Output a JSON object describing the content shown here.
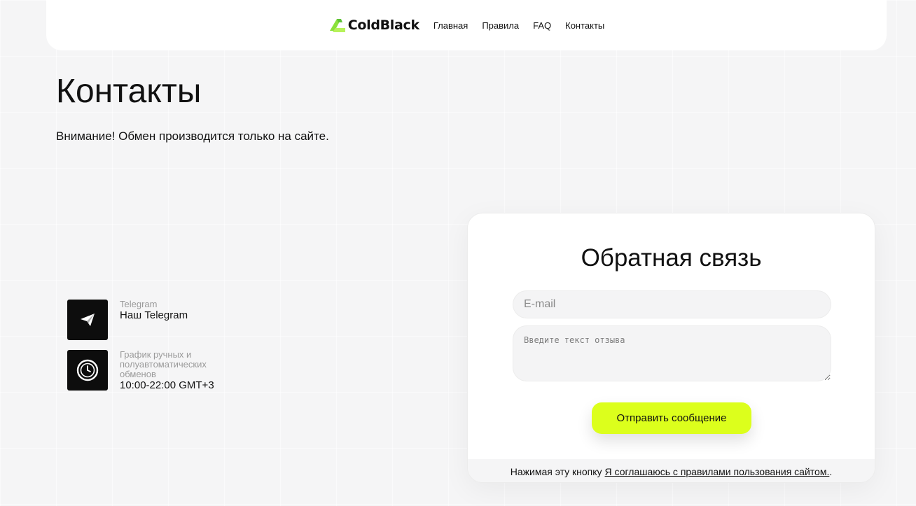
{
  "header": {
    "logo_text": "ColdBlack",
    "nav": [
      "Главная",
      "Правила",
      "FAQ",
      "Контакты"
    ]
  },
  "page": {
    "title": "Контакты",
    "notice": "Внимание! Обмен производится только на сайте."
  },
  "contacts": [
    {
      "icon": "telegram-icon",
      "label": "Telegram",
      "value": "Наш Telegram"
    },
    {
      "icon": "clock-icon",
      "label": "График ручных и полуавтоматических обменов",
      "value": "10:00-22:00 GMT+3"
    }
  ],
  "form": {
    "title": "Обратная связь",
    "email_placeholder": "E-mail",
    "message_placeholder": "Введите текст отзыва",
    "submit_label": "Отправить сообщение",
    "footer_prefix": "Нажимая эту кнопку",
    "footer_link": "Я соглашаюсь с правилами пользования сайтом. ",
    "footer_suffix": "."
  },
  "colors": {
    "accent": "#dcff1c",
    "logo_green": "#8be13c",
    "icon_bg": "#0d0d0d"
  }
}
